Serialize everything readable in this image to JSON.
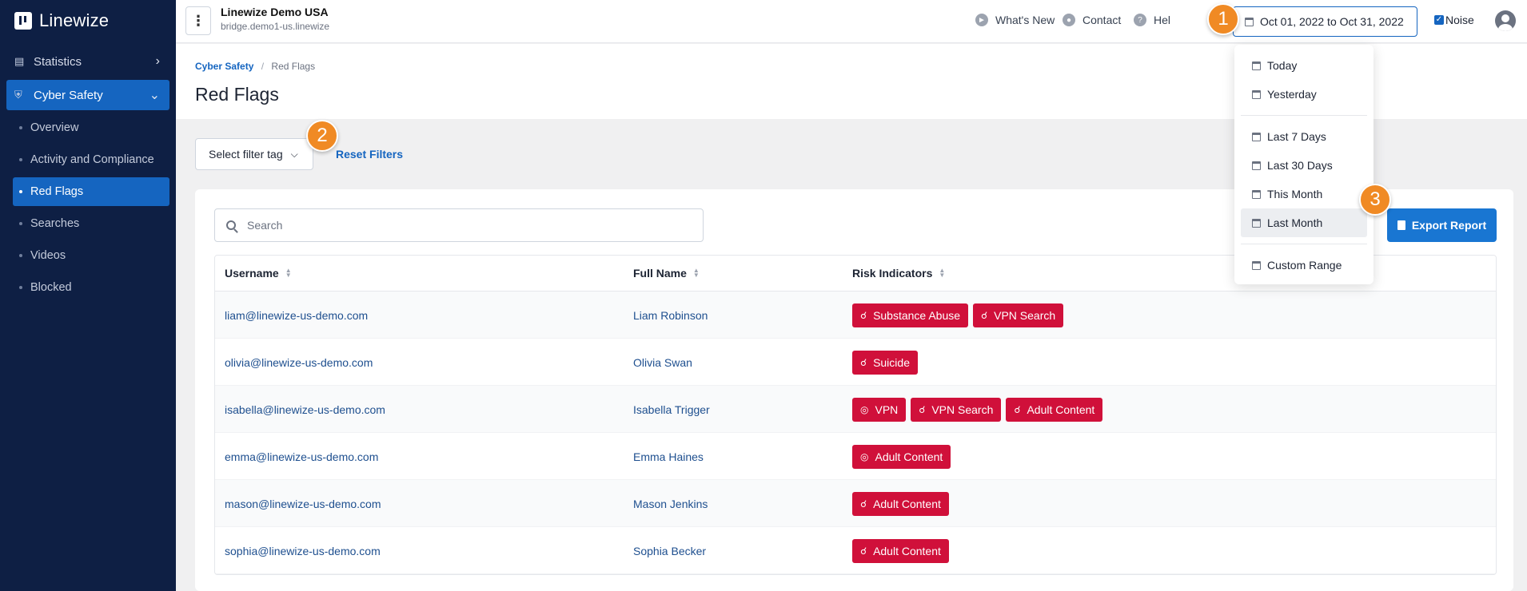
{
  "app": {
    "name": "Linewize"
  },
  "sidebar": {
    "items": [
      {
        "label": "Statistics",
        "icon": "chart-icon"
      },
      {
        "label": "Cyber Safety",
        "icon": "shield-icon"
      }
    ],
    "subitems": [
      {
        "label": "Overview"
      },
      {
        "label": "Activity and Compliance"
      },
      {
        "label": "Red Flags"
      },
      {
        "label": "Searches"
      },
      {
        "label": "Videos"
      },
      {
        "label": "Blocked"
      }
    ]
  },
  "topbar": {
    "org_title": "Linewize Demo USA",
    "org_sub": "bridge.demo1-us.linewize",
    "whats_new": "What's New",
    "contact": "Contact",
    "help": "Hel",
    "date_range": "Oct 01, 2022 to Oct 31, 2022",
    "noise": "Noise"
  },
  "breadcrumb": {
    "parent": "Cyber Safety",
    "sep": "/",
    "current": "Red Flags"
  },
  "page": {
    "title": "Red Flags"
  },
  "filters": {
    "select_label": "Select filter tag",
    "reset_label": "Reset Filters"
  },
  "search": {
    "placeholder": "Search"
  },
  "export": {
    "label": "Export Report"
  },
  "table": {
    "headers": [
      "Username",
      "Full Name",
      "Risk Indicators"
    ],
    "rows": [
      {
        "username": "liam@linewize-us-demo.com",
        "fullname": "Liam Robinson",
        "tags": [
          {
            "label": "Substance Abuse",
            "icon": "search-icon"
          },
          {
            "label": "VPN Search",
            "icon": "search-icon"
          }
        ]
      },
      {
        "username": "olivia@linewize-us-demo.com",
        "fullname": "Olivia Swan",
        "tags": [
          {
            "label": "Suicide",
            "icon": "search-icon"
          }
        ]
      },
      {
        "username": "isabella@linewize-us-demo.com",
        "fullname": "Isabella Trigger",
        "tags": [
          {
            "label": "VPN",
            "icon": "globe-icon"
          },
          {
            "label": "VPN Search",
            "icon": "search-icon"
          },
          {
            "label": "Adult Content",
            "icon": "search-icon"
          }
        ]
      },
      {
        "username": "emma@linewize-us-demo.com",
        "fullname": "Emma Haines",
        "tags": [
          {
            "label": "Adult Content",
            "icon": "globe-icon"
          }
        ]
      },
      {
        "username": "mason@linewize-us-demo.com",
        "fullname": "Mason Jenkins",
        "tags": [
          {
            "label": "Adult Content",
            "icon": "search-icon"
          }
        ]
      },
      {
        "username": "sophia@linewize-us-demo.com",
        "fullname": "Sophia Becker",
        "tags": [
          {
            "label": "Adult Content",
            "icon": "search-icon"
          }
        ]
      }
    ]
  },
  "date_dropdown": {
    "group1": [
      "Today",
      "Yesterday"
    ],
    "group2": [
      "Last 7 Days",
      "Last 30 Days",
      "This Month",
      "Last Month"
    ],
    "group3": [
      "Custom Range"
    ],
    "highlighted": "Last Month"
  },
  "markers": [
    "1",
    "2",
    "3"
  ],
  "colors": {
    "sidebar_bg": "#0e1f44",
    "accent": "#1565c0",
    "tag_red": "#d0103a",
    "marker_orange": "#f08a24"
  }
}
